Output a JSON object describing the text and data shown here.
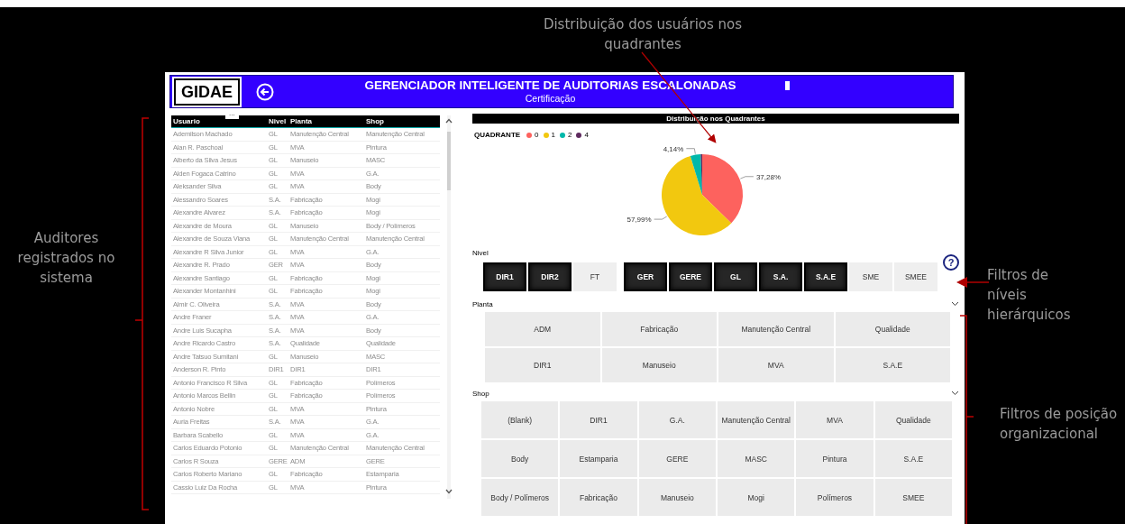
{
  "annotations": {
    "top": "Distribuição dos usuários nos quadrantes",
    "left": "Auditores registrados no sistema",
    "right_top": "Filtros de níveis hierárquicos",
    "right_bottom": "Filtros de posição organizacional"
  },
  "header": {
    "logo": "GIDAE",
    "title": "GERENCIADOR INTELIGENTE DE AUDITORIAS ESCALONADAS",
    "subtitle": "Certificação"
  },
  "table": {
    "more_options": "...",
    "columns": [
      "Usuario",
      "Nivel",
      "Planta",
      "Shop"
    ],
    "rows": [
      [
        "Ademilson Machado",
        "GL",
        "Manutenção Central",
        "Manutenção Central"
      ],
      [
        "Alan R. Paschoal",
        "GL",
        "MVA",
        "Pintura"
      ],
      [
        "Alberto da Silva Jesus",
        "GL",
        "Manuseio",
        "MASC"
      ],
      [
        "Alden Fogaca Catrino",
        "GL",
        "MVA",
        "G.A."
      ],
      [
        "Aleksander Silva",
        "GL",
        "MVA",
        "Body"
      ],
      [
        "Alessandro Soares",
        "S.A.",
        "Fabricação",
        "Mogi"
      ],
      [
        "Alexandre Alvarez",
        "S.A.",
        "Fabricação",
        "Mogi"
      ],
      [
        "Alexandre de Moura",
        "GL",
        "Manuseio",
        "Body / Polímeros"
      ],
      [
        "Alexandre de Souza Viana",
        "GL",
        "Manutenção Central",
        "Manutenção Central"
      ],
      [
        "Alexandre R Silva Junior",
        "GL",
        "MVA",
        "G.A."
      ],
      [
        "Alexandre R. Prado",
        "GER",
        "MVA",
        "Body"
      ],
      [
        "Alexandre Santiago",
        "GL",
        "Fabricação",
        "Mogi"
      ],
      [
        "Alexander Montanhini",
        "GL",
        "Fabricação",
        "Mogi"
      ],
      [
        "Almir C. Oliveira",
        "S.A.",
        "MVA",
        "Body"
      ],
      [
        "Andre Franer",
        "S.A.",
        "MVA",
        "G.A."
      ],
      [
        "Andre Luis Sucapha",
        "S.A.",
        "MVA",
        "Body"
      ],
      [
        "Andre Ricardo Castro",
        "S.A.",
        "Qualidade",
        "Qualidade"
      ],
      [
        "Andre Tatsuo Sumitani",
        "GL",
        "Manuseio",
        "MASC"
      ],
      [
        "Anderson R. Pinto",
        "DIR1",
        "DIR1",
        "DIR1"
      ],
      [
        "Antonio Francisco R Silva",
        "GL",
        "Fabricação",
        "Polímeros"
      ],
      [
        "Antonio Marcos Bellin",
        "GL",
        "Fabricação",
        "Polímeros"
      ],
      [
        "Antonio Nobre",
        "GL",
        "MVA",
        "Pintura"
      ],
      [
        "Auria Freitas",
        "S.A.",
        "MVA",
        "G.A."
      ],
      [
        "Barbara Scabello",
        "GL",
        "MVA",
        "G.A."
      ],
      [
        "Carlos Eduardo Potonio",
        "GL",
        "Manutenção Central",
        "Manutenção Central"
      ],
      [
        "Carlos R Souza",
        "GERE",
        "ADM",
        "GERE"
      ],
      [
        "Carlos Roberto Mariano",
        "GL",
        "Fabricação",
        "Estamparia"
      ],
      [
        "Cassio Luiz Da Rocha",
        "GL",
        "MVA",
        "Pintura"
      ]
    ]
  },
  "chart": {
    "title": "Distribuição nos Quadrantes",
    "chart_data": {
      "type": "pie",
      "legend_title": "QUADRANTE",
      "categories": [
        "0",
        "1",
        "2",
        "4"
      ],
      "values": [
        37.28,
        57.99,
        4.14,
        0.59
      ],
      "colors": [
        "#fd625e",
        "#f2c80f",
        "#01b8aa",
        "#5f2b5f"
      ],
      "value_labels": [
        "37,28%",
        "57,99%",
        "4,14%",
        null
      ]
    }
  },
  "help": "?",
  "nivel": {
    "label": "Nivel",
    "items": [
      {
        "label": "DIR1",
        "selected": true
      },
      {
        "label": "DIR2",
        "selected": true
      },
      {
        "label": "FT",
        "selected": false
      },
      {
        "label": "GER",
        "selected": true
      },
      {
        "label": "GERE",
        "selected": true
      },
      {
        "label": "GL",
        "selected": true
      },
      {
        "label": "S.A.",
        "selected": true
      },
      {
        "label": "S.A.E",
        "selected": true
      },
      {
        "label": "SME",
        "selected": false
      },
      {
        "label": "SMEE",
        "selected": false
      }
    ]
  },
  "planta": {
    "label": "Planta",
    "items": [
      "ADM",
      "Fabricação",
      "Manutenção Central",
      "Qualidade",
      "DIR1",
      "Manuseio",
      "MVA",
      "S.A.E"
    ]
  },
  "shop": {
    "label": "Shop",
    "items": [
      "(Blank)",
      "DIR1",
      "G.A.",
      "Manutenção Central",
      "MVA",
      "Qualidade",
      "Body",
      "Estamparia",
      "GERE",
      "MASC",
      "Pintura",
      "S.A.E",
      "Body / Polímeros",
      "Fabricação",
      "Manuseio",
      "Mogi",
      "Polímeros",
      "SMEE"
    ]
  }
}
